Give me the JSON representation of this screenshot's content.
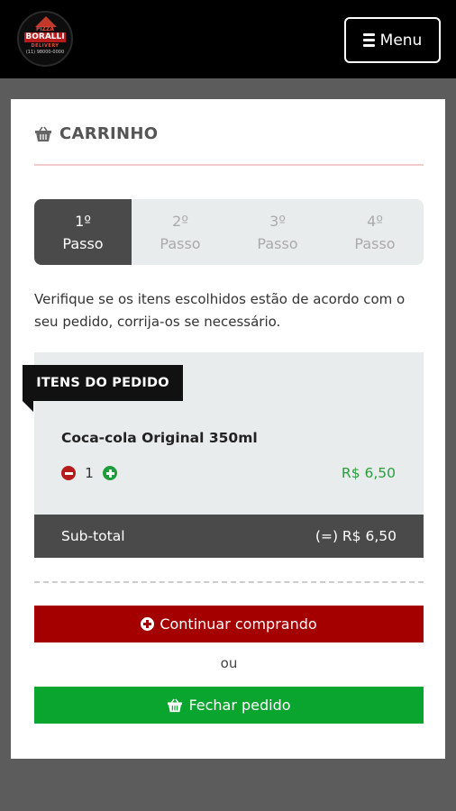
{
  "header": {
    "logo": {
      "line1": "PIZZA",
      "line2": "BORALLI",
      "line3": "DELIVERY",
      "line4": "(11) 98000-0000"
    },
    "menu_label": "Menu"
  },
  "cart": {
    "title": "CARRINHO",
    "steps": [
      {
        "number": "1º",
        "label": "Passo",
        "active": true
      },
      {
        "number": "2º",
        "label": "Passo",
        "active": false
      },
      {
        "number": "3º",
        "label": "Passo",
        "active": false
      },
      {
        "number": "4º",
        "label": "Passo",
        "active": false
      }
    ],
    "instructions": "Verifique se os itens escolhidos estão de acordo com o seu pedido, corrija-os se necessário.",
    "items_label": "ITENS DO PEDIDO",
    "items": [
      {
        "name": "Coca-cola Original 350ml",
        "quantity": "1",
        "price": "R$ 6,50"
      }
    ],
    "subtotal_label": "Sub-total",
    "subtotal_value": "(=) R$ 6,50",
    "continue_label": "Continuar comprando",
    "or_label": "ou",
    "close_label": "Fechar pedido"
  },
  "colors": {
    "continue": "#a50000",
    "close": "#0aa52e",
    "price": "#2a9d3a",
    "minus": "#b71c1c",
    "plus": "#1f9d3a"
  }
}
